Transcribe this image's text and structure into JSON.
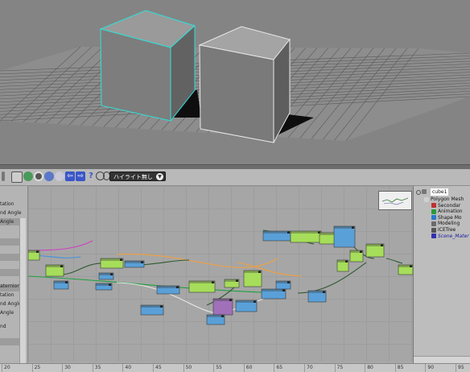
{
  "toolbar": {
    "icons": [
      "lock-icon",
      "refresh-icon",
      "record-icon",
      "sphere-icon",
      "arrow-left-icon",
      "arrow-right-icon",
      "help-icon",
      "clock-icon",
      "user-icon"
    ],
    "help_label": "?",
    "dropdown_value": "ハイライト無し"
  },
  "left_panel": {
    "items": [
      "tation",
      "nd Angle",
      "Angle",
      "",
      "",
      "",
      "",
      "aternion",
      "tation",
      "nd Angle",
      "Angle",
      "nd",
      ""
    ]
  },
  "explorer": {
    "root": "cube1",
    "items": [
      {
        "label": "Polygon Mesh",
        "icon": "mesh-icon",
        "color": "#d0d0d0"
      },
      {
        "label": "Secondar",
        "icon": "secondary-shape-icon",
        "color": "#c03030"
      },
      {
        "label": "Animation",
        "icon": "animation-icon",
        "color": "#2a9a3a"
      },
      {
        "label": "Shape Mo",
        "icon": "shape-modeling-icon",
        "color": "#2a7acc"
      },
      {
        "label": "Modeling",
        "icon": "modeling-icon",
        "color": "#6a6a6a"
      },
      {
        "label": "ICETree",
        "icon": "icetree-icon",
        "color": "#555555"
      },
      {
        "label": "Scene_Mater",
        "icon": "material-icon",
        "color": "#3030b0"
      }
    ]
  },
  "ruler": {
    "ticks": [
      "20",
      "25",
      "30",
      "35",
      "40",
      "45",
      "50",
      "55",
      "60",
      "65",
      "70",
      "75",
      "80",
      "85",
      "90",
      "95"
    ]
  },
  "colors": {
    "viewport": "#848484",
    "cube_edge": "#2ee0d8",
    "node_green": "#a6dd5a",
    "node_blue": "#5aa0d8",
    "node_purple": "#a070b8",
    "wire_orange": "#f0a040",
    "wire_magenta": "#d040c0",
    "wire_green": "#20a040"
  }
}
